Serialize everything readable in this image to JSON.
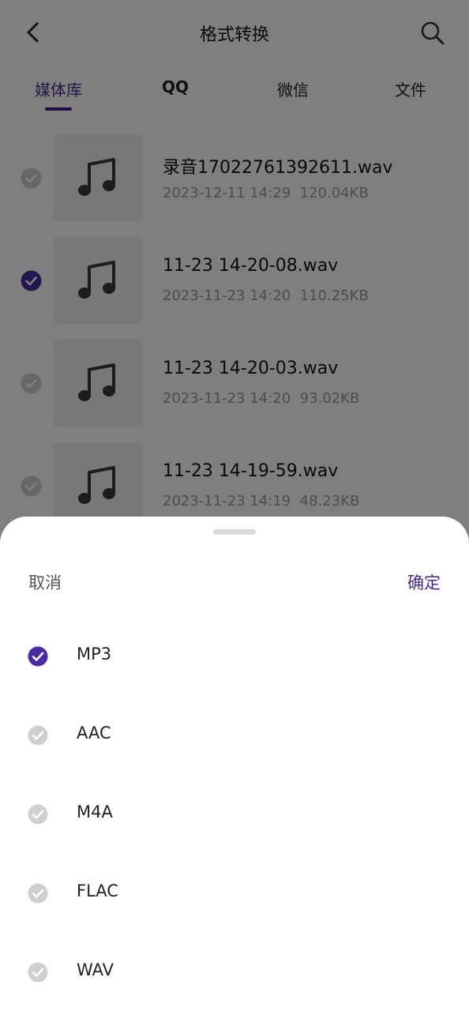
{
  "header": {
    "title": "格式转换",
    "back_icon": "back-arrow-icon",
    "search_icon": "search-icon"
  },
  "tabs": [
    {
      "label": "媒体库",
      "active": true
    },
    {
      "label": "QQ",
      "active": false
    },
    {
      "label": "微信",
      "active": false
    },
    {
      "label": "文件",
      "active": false
    }
  ],
  "files": [
    {
      "name": "录音17022761392611.wav",
      "date": "2023-12-11 14:29",
      "size": "120.04KB",
      "selected": false
    },
    {
      "name": "11-23 14-20-08.wav",
      "date": "2023-11-23 14:20",
      "size": "110.25KB",
      "selected": true
    },
    {
      "name": "11-23 14-20-03.wav",
      "date": "2023-11-23 14:20",
      "size": "93.02KB",
      "selected": false
    },
    {
      "name": "11-23 14-19-59.wav",
      "date": "2023-11-23 14:19",
      "size": "48.23KB",
      "selected": false
    }
  ],
  "sheet": {
    "cancel": "取消",
    "confirm": "确定",
    "options": [
      {
        "label": "MP3",
        "selected": true
      },
      {
        "label": "AAC",
        "selected": false
      },
      {
        "label": "M4A",
        "selected": false
      },
      {
        "label": "FLAC",
        "selected": false
      },
      {
        "label": "WAV",
        "selected": false
      }
    ]
  },
  "colors": {
    "accent": "#4a2a8f",
    "check_selected": "#4b2aa3",
    "check_unselected": "#cfcfcf"
  }
}
